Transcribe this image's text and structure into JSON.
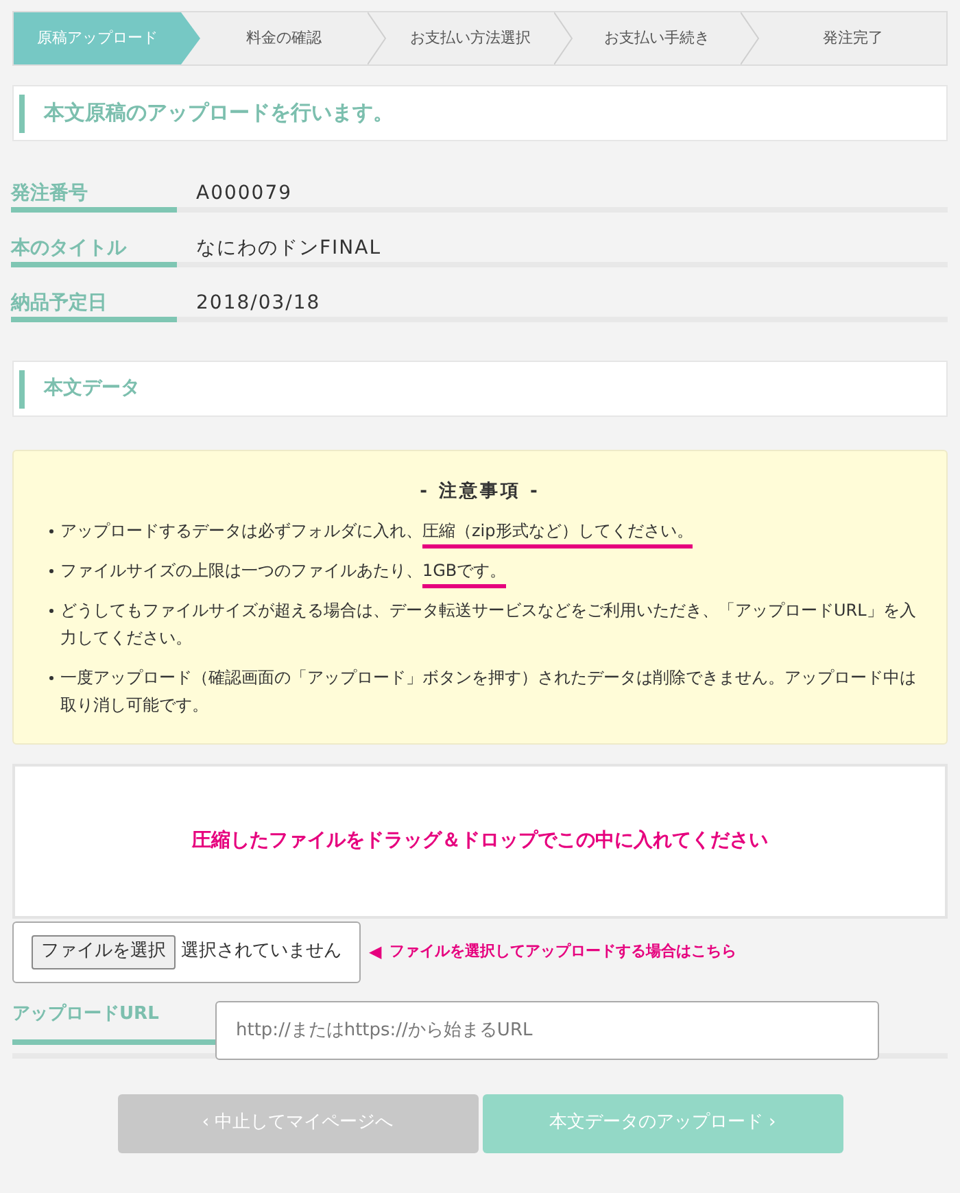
{
  "steps": [
    {
      "label": "原稿アップロード",
      "selected": true
    },
    {
      "label": "料金の確認",
      "selected": false
    },
    {
      "label": "お支払い方法選択",
      "selected": false
    },
    {
      "label": "お支払い手続き",
      "selected": false
    },
    {
      "label": "発注完了",
      "selected": false
    }
  ],
  "page_heading": "本文原稿のアップロードを行います。",
  "details": [
    {
      "label": "発注番号",
      "value": "A000079"
    },
    {
      "label": "本のタイトル",
      "value": "なにわのドンFINAL"
    },
    {
      "label": "納品予定日",
      "value": "2018/03/18"
    }
  ],
  "section_heading": "本文データ",
  "notice": {
    "title": "- 注意事項 -",
    "items": [
      {
        "text": "アップロードするデータは必ずフォルダに入れ、",
        "emphasis": "圧縮（zip形式など）してください。"
      },
      {
        "text": "ファイルサイズの上限は一つのファイルあたり、",
        "emphasis": "1GBです。"
      },
      {
        "text": "どうしてもファイルサイズが超える場合は、データ転送サービスなどをご利用いただき、「アップロードURL」を入力してください。"
      },
      {
        "text": "一度アップロード（確認画面の「アップロード」ボタンを押す）されたデータは削除できません。アップロード中は取り消し可能です。"
      }
    ]
  },
  "dropzone": {
    "text": "圧縮したファイルをドラッグ＆ドロップでこの中に入れてください"
  },
  "file_picker": {
    "button": "ファイルを選択",
    "status": "選択されていません",
    "arrow": "◀",
    "hint": "ファイルを選択してアップロードする場合はこちら"
  },
  "upload_url": {
    "label": "アップロードURL",
    "placeholder": "http://またはhttps://から始まるURL"
  },
  "buttons": [
    {
      "label": "‹ 中止してマイページへ",
      "kind": "secondary"
    },
    {
      "label": "本文データのアップロード ›",
      "kind": "primary"
    }
  ]
}
